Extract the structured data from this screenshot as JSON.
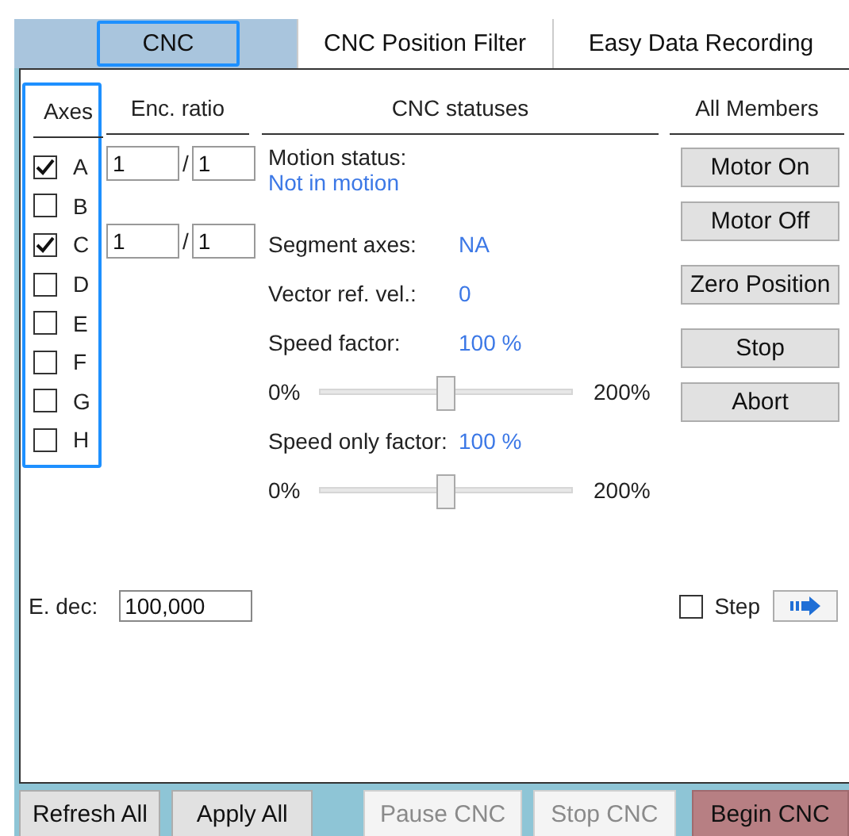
{
  "tabs": [
    {
      "label": "CNC",
      "selected": true
    },
    {
      "label": "CNC Position Filter",
      "selected": false
    },
    {
      "label": "Easy Data Recording",
      "selected": false
    }
  ],
  "axes": {
    "header": "Axes",
    "ratio_header": "Enc. ratio",
    "items": [
      {
        "label": "A",
        "checked": true,
        "ratio": {
          "numerator": "1",
          "separator": "/",
          "denominator": "1"
        }
      },
      {
        "label": "B",
        "checked": false
      },
      {
        "label": "C",
        "checked": true,
        "ratio": {
          "numerator": "1",
          "separator": "/",
          "denominator": "1"
        }
      },
      {
        "label": "D",
        "checked": false
      },
      {
        "label": "E",
        "checked": false
      },
      {
        "label": "F",
        "checked": false
      },
      {
        "label": "G",
        "checked": false
      },
      {
        "label": "H",
        "checked": false
      }
    ]
  },
  "statuses": {
    "header": "CNC statuses",
    "motion_status": {
      "label": "Motion status:",
      "value": "Not in motion"
    },
    "segment_axes": {
      "label": "Segment axes:",
      "value": "NA"
    },
    "vector_ref_vel": {
      "label": "Vector ref. vel.:",
      "value": "0"
    },
    "speed_factor": {
      "label": "Speed factor:",
      "value": "100 %",
      "slider": {
        "min_label": "0%",
        "max_label": "200%",
        "level": 0.5
      }
    },
    "speed_only_factor": {
      "label": "Speed only factor:",
      "value": "100 %",
      "slider": {
        "min_label": "0%",
        "max_label": "200%",
        "level": 0.5
      }
    }
  },
  "members": {
    "header": "All Members",
    "button_groups": [
      [
        "Motor On",
        "Motor Off"
      ],
      [
        "Zero Position"
      ],
      [
        "Stop",
        "Abort"
      ]
    ]
  },
  "e_dec": {
    "label": "E. dec:",
    "value": "100,000"
  },
  "step": {
    "label": "Step",
    "checked": false
  },
  "footer": [
    {
      "label": "Refresh All",
      "disabled": false,
      "highlighted": false
    },
    {
      "label": "Apply All",
      "disabled": false,
      "highlighted": false
    },
    {
      "label": "Pause CNC",
      "disabled": true,
      "highlighted": false
    },
    {
      "label": "Stop CNC",
      "disabled": true,
      "highlighted": false
    },
    {
      "label": "Begin CNC",
      "disabled": false,
      "highlighted": true
    }
  ]
}
